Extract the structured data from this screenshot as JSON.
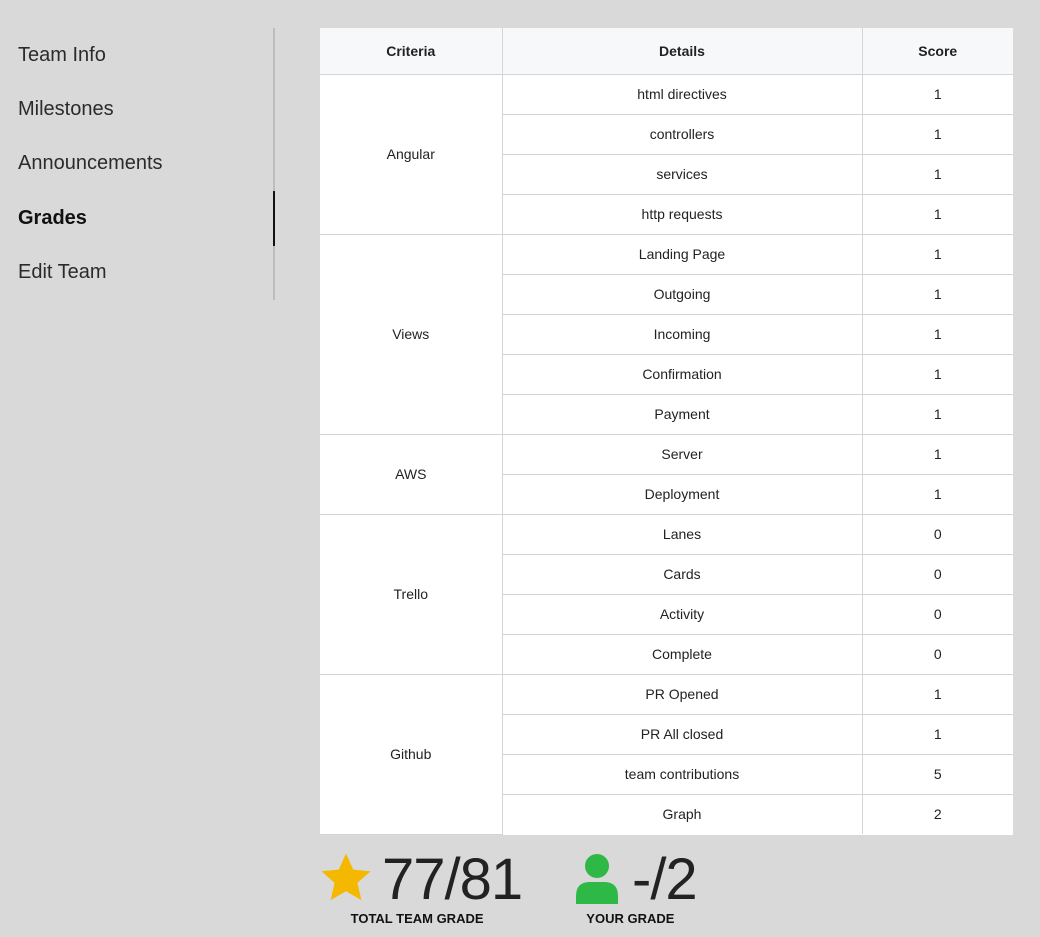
{
  "sidebar": {
    "items": [
      {
        "label": "Team Info"
      },
      {
        "label": "Milestones"
      },
      {
        "label": "Announcements"
      },
      {
        "label": "Grades"
      },
      {
        "label": "Edit Team"
      }
    ],
    "active_index": 3
  },
  "table": {
    "headers": [
      "Criteria",
      "Details",
      "Score"
    ],
    "groups": [
      {
        "criteria": "Angular",
        "rows": [
          {
            "detail": "html directives",
            "score": "1"
          },
          {
            "detail": "controllers",
            "score": "1"
          },
          {
            "detail": "services",
            "score": "1"
          },
          {
            "detail": "http requests",
            "score": "1"
          }
        ]
      },
      {
        "criteria": "Views",
        "rows": [
          {
            "detail": "Landing Page",
            "score": "1"
          },
          {
            "detail": "Outgoing",
            "score": "1"
          },
          {
            "detail": "Incoming",
            "score": "1"
          },
          {
            "detail": "Confirmation",
            "score": "1"
          },
          {
            "detail": "Payment",
            "score": "1"
          }
        ]
      },
      {
        "criteria": "AWS",
        "rows": [
          {
            "detail": "Server",
            "score": "1"
          },
          {
            "detail": "Deployment",
            "score": "1"
          }
        ]
      },
      {
        "criteria": "Trello",
        "rows": [
          {
            "detail": "Lanes",
            "score": "0"
          },
          {
            "detail": "Cards",
            "score": "0"
          },
          {
            "detail": "Activity",
            "score": "0"
          },
          {
            "detail": "Complete",
            "score": "0"
          }
        ]
      },
      {
        "criteria": "Github",
        "rows": [
          {
            "detail": "PR Opened",
            "score": "1"
          },
          {
            "detail": "PR All closed",
            "score": "1"
          },
          {
            "detail": "team contributions",
            "score": "5"
          },
          {
            "detail": "Graph",
            "score": "2"
          }
        ]
      }
    ]
  },
  "summary": {
    "team_grade": {
      "value": "77/81",
      "label": "TOTAL TEAM GRADE",
      "icon": "star-icon",
      "color": "#f5b800"
    },
    "your_grade": {
      "value": "-/2",
      "label": "YOUR GRADE",
      "icon": "user-icon",
      "color": "#2eb845"
    }
  }
}
